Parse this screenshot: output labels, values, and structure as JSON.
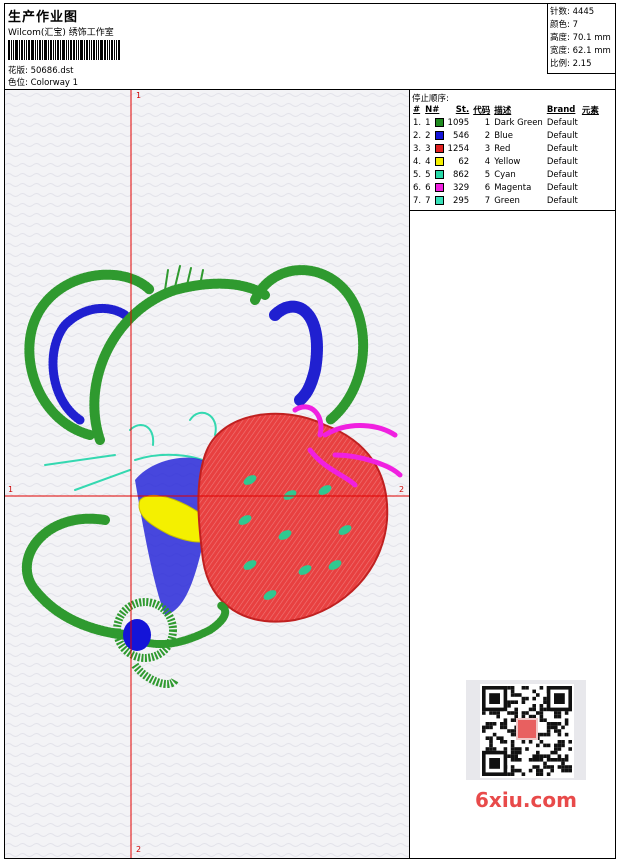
{
  "header": {
    "title": "生产作业图",
    "studio": "Wilcom(汇宝) 绣饰工作室",
    "design_label": "花版:",
    "design_value": "50686.dst",
    "colorway_label": "色位:",
    "colorway_value": "Colorway 1"
  },
  "stats": {
    "stitches": "针数: 4445",
    "colors": "颜色: 7",
    "height": "高度: 70.1 mm",
    "width": "宽度: 62.1 mm",
    "scale": "比例: 2.15"
  },
  "stop_sequence": {
    "title": "停止顺序:",
    "headers": [
      "#",
      "N#",
      "St.",
      "代码",
      "描述",
      "Brand",
      "元素"
    ],
    "rows": [
      {
        "idx": "1.",
        "n": "1",
        "color": "#1f8a1f",
        "st": "1095",
        "code": "1",
        "desc": "Dark Green",
        "brand": "Default"
      },
      {
        "idx": "2.",
        "n": "2",
        "color": "#1414d8",
        "st": "546",
        "code": "2",
        "desc": "Blue",
        "brand": "Default"
      },
      {
        "idx": "3.",
        "n": "3",
        "color": "#e02020",
        "st": "1254",
        "code": "3",
        "desc": "Red",
        "brand": "Default"
      },
      {
        "idx": "4.",
        "n": "4",
        "color": "#f4f000",
        "st": "62",
        "code": "4",
        "desc": "Yellow",
        "brand": "Default"
      },
      {
        "idx": "5.",
        "n": "5",
        "color": "#28d8a8",
        "st": "862",
        "code": "5",
        "desc": "Cyan",
        "brand": "Default"
      },
      {
        "idx": "6.",
        "n": "6",
        "color": "#f020e0",
        "st": "329",
        "code": "6",
        "desc": "Magenta",
        "brand": "Default"
      },
      {
        "idx": "7.",
        "n": "7",
        "color": "#38e0b8",
        "st": "295",
        "code": "7",
        "desc": "Green",
        "brand": "Default"
      }
    ]
  },
  "axes": {
    "top": "1",
    "bottom": "2",
    "left": "1",
    "right": "2"
  },
  "watermark": "6xiu.com",
  "colors": {
    "axis": "#e00000",
    "dark_green": "#1f8a1f",
    "blue": "#1414d8",
    "red": "#e02020",
    "yellow": "#f4f000",
    "cyan": "#28d8a8",
    "magenta": "#f020e0",
    "green": "#38e0b8"
  }
}
